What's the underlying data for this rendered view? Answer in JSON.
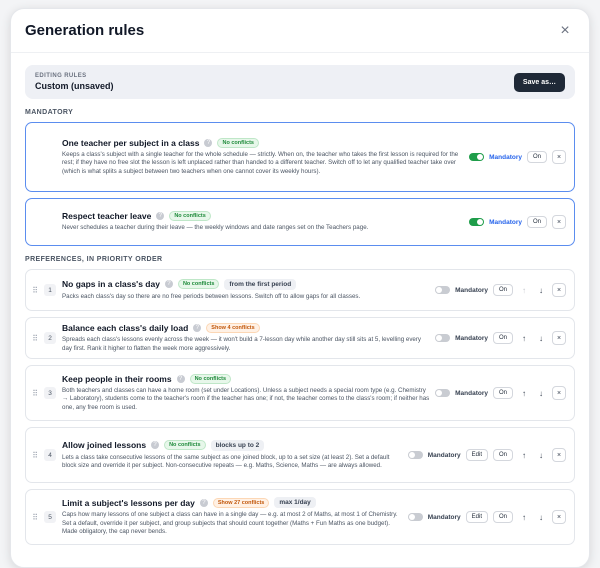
{
  "modal": {
    "title": "Generation rules",
    "close_glyph": "×"
  },
  "editing": {
    "label": "EDITING RULES",
    "name": "Custom (unsaved)",
    "save_label": "Save as…"
  },
  "sections": {
    "mandatory": "MANDATORY",
    "preferences": "PREFERENCES, IN PRIORITY ORDER"
  },
  "controls": {
    "mandatory_label": "Mandatory",
    "on_label": "On",
    "edit_label": "Edit",
    "help_glyph": "?",
    "grip_glyph": "⠿",
    "up_glyph": "↑",
    "down_glyph": "↓",
    "close_glyph": "×"
  },
  "colors": {
    "accent": "#2563eb",
    "toggle_on": "#1f9d4a",
    "ok": "#1e8a3a",
    "warn": "#c2580c",
    "border_mandatory": "#5b8def"
  },
  "mandatory_rules": [
    {
      "title": "One teacher per subject in a class",
      "badge": "No conflicts",
      "description": "Keeps a class's subject with a single teacher for the whole schedule — strictly. When on, the teacher who takes the first lesson is required for the rest; if they have no free slot the lesson is left unplaced rather than handed to a different teacher. Switch off to let any qualified teacher take over (which is what splits a subject between two teachers when one cannot cover its weekly hours)."
    },
    {
      "title": "Respect teacher leave",
      "badge": "No conflicts",
      "description": "Never schedules a teacher during their leave — the weekly windows and date ranges set on the Teachers page."
    }
  ],
  "preference_rules": [
    {
      "num": "1",
      "title": "No gaps in a class's day",
      "badge": "No conflicts",
      "chip": "from the first period",
      "description": "Packs each class's day so there are no free periods between lessons. Switch off to allow gaps for all classes."
    },
    {
      "num": "2",
      "title": "Balance each class's daily load",
      "badge": "Show 4 conflicts",
      "description": "Spreads each class's lessons evenly across the week — it won't build a 7-lesson day while another day still sits at 5, levelling every day first. Rank it higher to flatten the week more aggressively."
    },
    {
      "num": "3",
      "title": "Keep people in their rooms",
      "badge": "No conflicts",
      "description": "Both teachers and classes can have a home room (set under Locations). Unless a subject needs a special room type (e.g. Chemistry → Laboratory), students come to the teacher's room if the teacher has one; if not, the teacher comes to the class's room; if neither has one, any free room is used."
    },
    {
      "num": "4",
      "title": "Allow joined lessons",
      "badge": "No conflicts",
      "chip": "blocks up to 2",
      "description": "Lets a class take consecutive lessons of the same subject as one joined block, up to a set size (at least 2). Set a default block size and override it per subject. Non-consecutive repeats — e.g. Maths, Science, Maths — are always allowed."
    },
    {
      "num": "5",
      "title": "Limit a subject's lessons per day",
      "badge": "Show 27 conflicts",
      "chip": "max 1/day",
      "description": "Caps how many lessons of one subject a class can have in a single day — e.g. at most 2 of Maths, at most 1 of Chemistry. Set a default, override it per subject, and group subjects that should count together (Maths + Fun Maths as one budget). Made obligatory, the cap never bends."
    }
  ]
}
